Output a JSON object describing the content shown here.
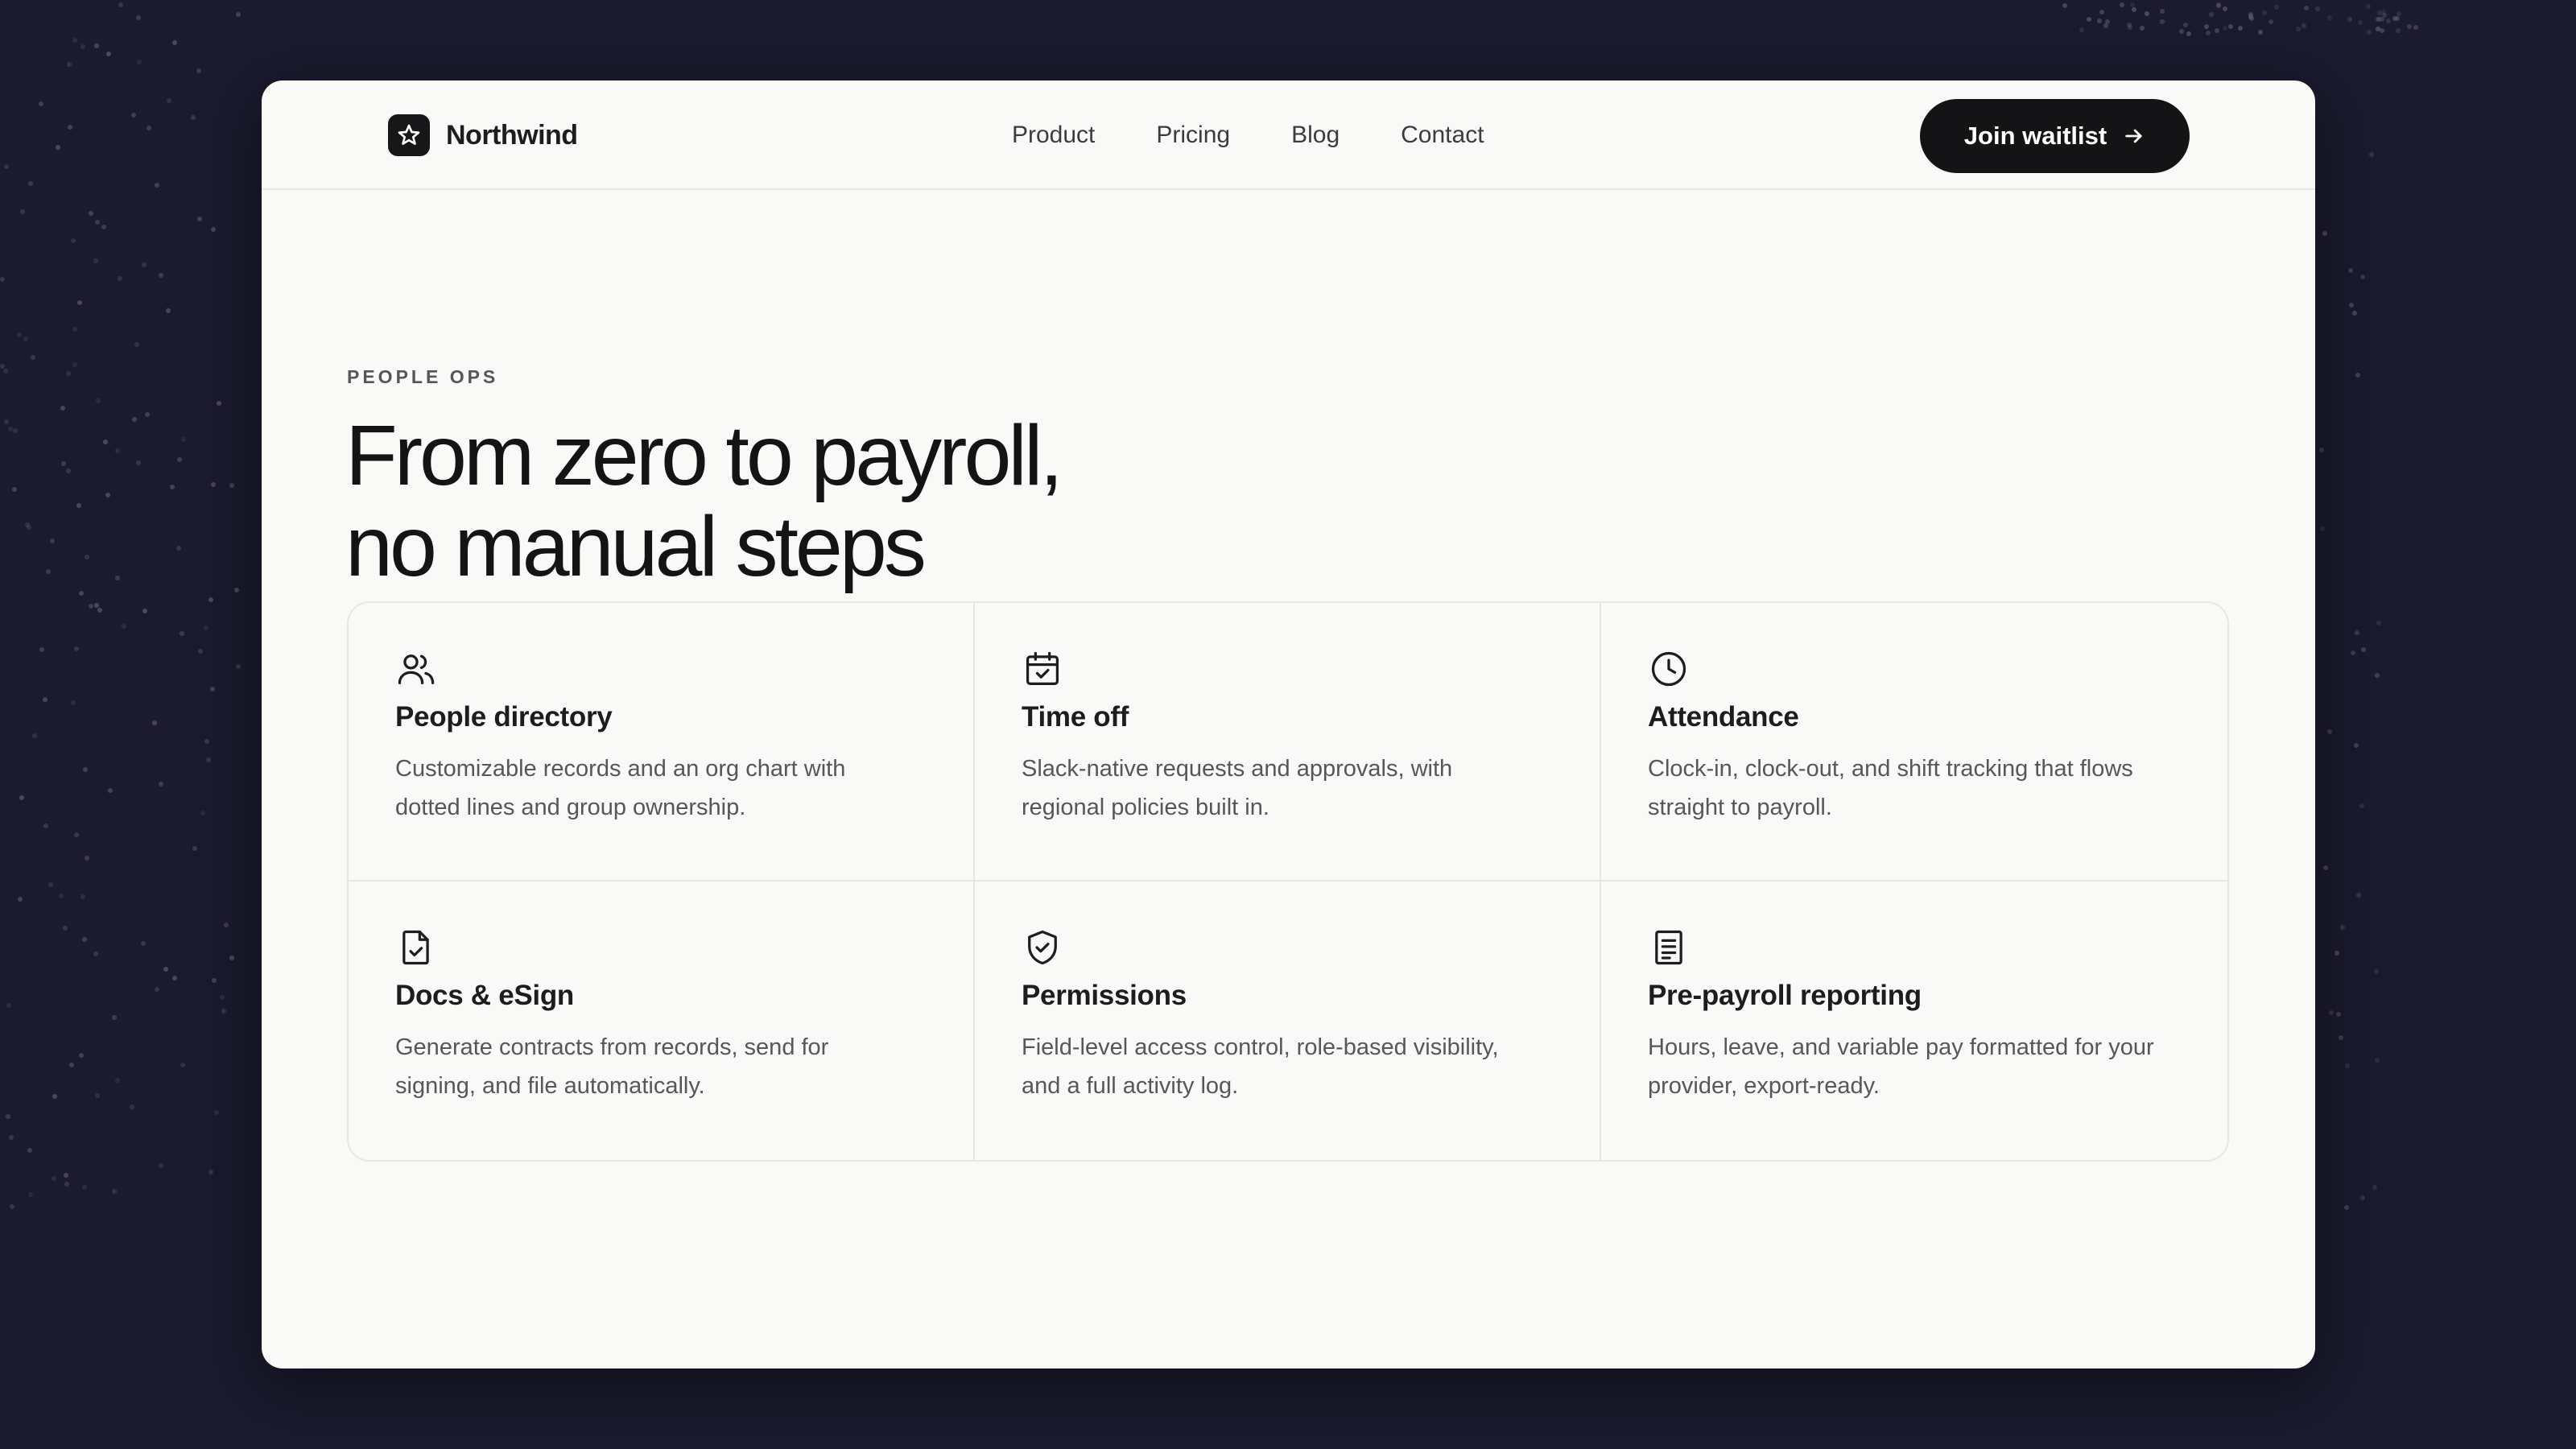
{
  "brand": {
    "name": "Northwind",
    "logo_icon": "star-icon"
  },
  "nav": {
    "links": [
      "Product",
      "Pricing",
      "Blog",
      "Contact"
    ],
    "cta_label": "Join waitlist",
    "cta_icon": "arrow-right-icon"
  },
  "hero": {
    "eyebrow": "PEOPLE OPS",
    "headline_line1": "From zero to payroll,",
    "headline_line2": "no manual steps"
  },
  "features": [
    {
      "icon": "users-icon",
      "title": "People directory",
      "description": "Customizable records and an org chart with dotted lines and group ownership."
    },
    {
      "icon": "calendar-check-icon",
      "title": "Time off",
      "description": "Slack-native requests and approvals, with regional policies built in."
    },
    {
      "icon": "clock-icon",
      "title": "Attendance",
      "description": "Clock-in, clock-out, and shift tracking that flows straight to payroll."
    },
    {
      "icon": "document-check-icon",
      "title": "Docs & eSign",
      "description": "Generate contracts from records, send for signing, and file automatically."
    },
    {
      "icon": "shield-check-icon",
      "title": "Permissions",
      "description": "Field-level access control, role-based visibility, and a full activity log."
    },
    {
      "icon": "receipt-icon",
      "title": "Pre-payroll reporting",
      "description": "Hours, leave, and variable pay formatted for your provider, export-ready."
    }
  ],
  "colors": {
    "backdrop": "#1b1a2e",
    "card": "#f9f9f7",
    "text": "#141416",
    "muted": "#56565c",
    "button": "#141416"
  }
}
